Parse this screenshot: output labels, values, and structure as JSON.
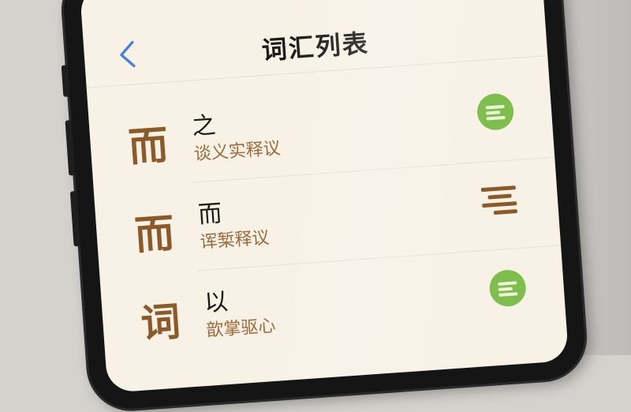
{
  "header": {
    "title": "词汇列表",
    "back_icon": "chevron-left-icon"
  },
  "colors": {
    "accent_brown": "#8a5a2b",
    "badge_green": "#7fbd4f",
    "screen_bg": "#f7f1e6"
  },
  "vocab_list": [
    {
      "big_char": "而",
      "word": "之",
      "subtitle": "谈义实释议",
      "action_icon": "green-circle-list-icon"
    },
    {
      "big_char": "而",
      "word": "而",
      "subtitle": "诨椠释议",
      "action_icon": "list-lines-icon"
    },
    {
      "big_char": "词",
      "word": "以",
      "subtitle": "歆掌驱心",
      "action_icon": "green-circle-list-icon"
    }
  ]
}
